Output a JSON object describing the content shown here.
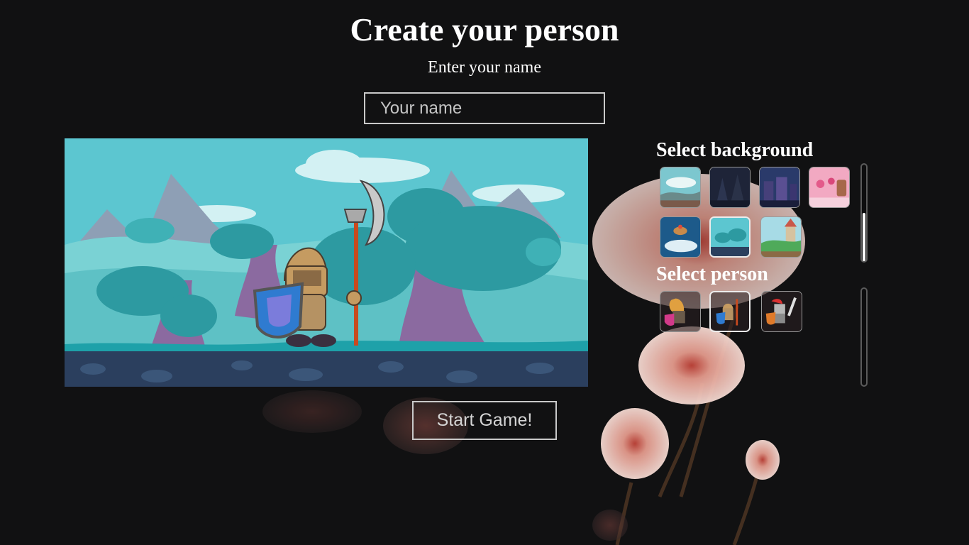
{
  "page": {
    "title": "Create your person",
    "name_prompt": "Enter your name"
  },
  "name_input": {
    "placeholder": "Your name",
    "value": ""
  },
  "start_button": {
    "label": "Start Game!"
  },
  "background_selector": {
    "heading": "Select background",
    "options": [
      {
        "icon": "cloudy-hills-thumbnail"
      },
      {
        "icon": "dark-forest-thumbnail"
      },
      {
        "icon": "night-city-thumbnail"
      },
      {
        "icon": "candy-land-thumbnail"
      },
      {
        "icon": "sky-island-thumbnail"
      },
      {
        "icon": "teal-forest-thumbnail"
      },
      {
        "icon": "castle-meadow-thumbnail"
      }
    ],
    "selected_index": 5,
    "scroll_position_fraction": 0.55
  },
  "person_selector": {
    "heading": "Select person",
    "options": [
      {
        "icon": "spartan-knight-thumbnail"
      },
      {
        "icon": "axe-knight-thumbnail"
      },
      {
        "icon": "sword-knight-thumbnail"
      }
    ],
    "selected_index": 1,
    "scroll_position_fraction": 0.0
  },
  "colors": {
    "background": "#111112",
    "border": "#c9c9c9",
    "preview_sky": "#5cc6d0",
    "preview_ground": "#2b3f5e"
  }
}
